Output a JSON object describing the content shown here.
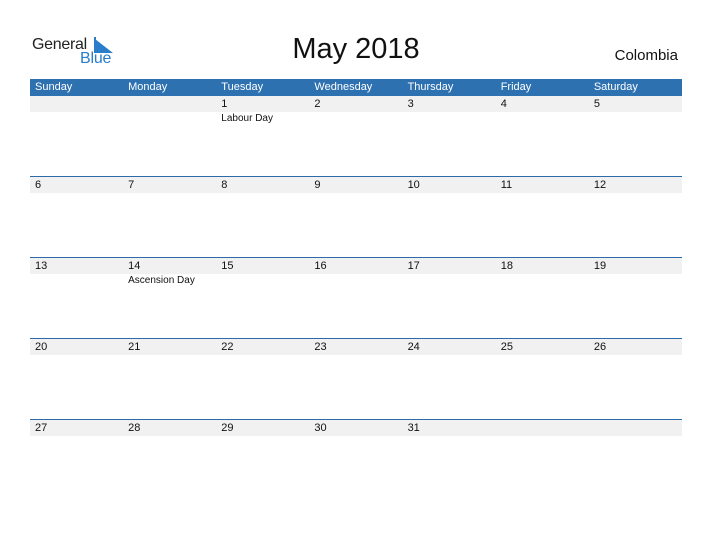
{
  "logo": {
    "general": "General",
    "blue": "Blue",
    "accent_color": "#2a7dc9"
  },
  "title": "May 2018",
  "country": "Colombia",
  "header_color": "#2e71b1",
  "weekdays": [
    "Sunday",
    "Monday",
    "Tuesday",
    "Wednesday",
    "Thursday",
    "Friday",
    "Saturday"
  ],
  "weeks": [
    {
      "days": [
        {
          "num": "",
          "holiday": ""
        },
        {
          "num": "",
          "holiday": ""
        },
        {
          "num": "1",
          "holiday": "Labour Day"
        },
        {
          "num": "2",
          "holiday": ""
        },
        {
          "num": "3",
          "holiday": ""
        },
        {
          "num": "4",
          "holiday": ""
        },
        {
          "num": "5",
          "holiday": ""
        }
      ]
    },
    {
      "days": [
        {
          "num": "6",
          "holiday": ""
        },
        {
          "num": "7",
          "holiday": ""
        },
        {
          "num": "8",
          "holiday": ""
        },
        {
          "num": "9",
          "holiday": ""
        },
        {
          "num": "10",
          "holiday": ""
        },
        {
          "num": "11",
          "holiday": ""
        },
        {
          "num": "12",
          "holiday": ""
        }
      ]
    },
    {
      "days": [
        {
          "num": "13",
          "holiday": ""
        },
        {
          "num": "14",
          "holiday": "Ascension Day"
        },
        {
          "num": "15",
          "holiday": ""
        },
        {
          "num": "16",
          "holiday": ""
        },
        {
          "num": "17",
          "holiday": ""
        },
        {
          "num": "18",
          "holiday": ""
        },
        {
          "num": "19",
          "holiday": ""
        }
      ]
    },
    {
      "days": [
        {
          "num": "20",
          "holiday": ""
        },
        {
          "num": "21",
          "holiday": ""
        },
        {
          "num": "22",
          "holiday": ""
        },
        {
          "num": "23",
          "holiday": ""
        },
        {
          "num": "24",
          "holiday": ""
        },
        {
          "num": "25",
          "holiday": ""
        },
        {
          "num": "26",
          "holiday": ""
        }
      ]
    },
    {
      "days": [
        {
          "num": "27",
          "holiday": ""
        },
        {
          "num": "28",
          "holiday": ""
        },
        {
          "num": "29",
          "holiday": ""
        },
        {
          "num": "30",
          "holiday": ""
        },
        {
          "num": "31",
          "holiday": ""
        },
        {
          "num": "",
          "holiday": ""
        },
        {
          "num": "",
          "holiday": ""
        }
      ]
    }
  ]
}
